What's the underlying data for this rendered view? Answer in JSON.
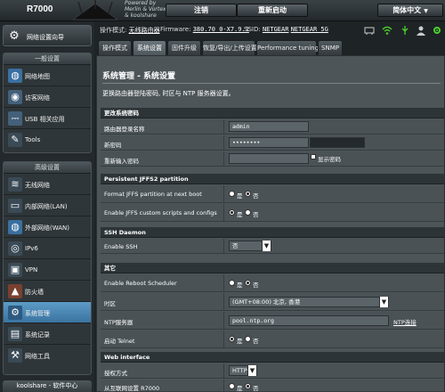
{
  "header": {
    "model": "R7000",
    "powered_by": [
      "Powered by",
      "Merlin & Vortex",
      "& koolshare"
    ],
    "logout_label": "注销",
    "reboot_label": "重新启动",
    "language_label": "简体中文"
  },
  "status": {
    "mode_label": "操作模式:",
    "mode_value": "无线路由器",
    "firmware_label": "Firmware:",
    "firmware_value": "380.70_0-X7.9.1",
    "ssid_label": "SSID:",
    "ssid_values": [
      "NETGEAR",
      "NETGEAR_5G"
    ],
    "icons": [
      "network-status-icon",
      "wifi-icon",
      "usb-icon",
      "user-icon",
      "settings-icon"
    ]
  },
  "sidebar": {
    "quick_setup": "网络设置向导",
    "general_title": "一般设置",
    "general_items": [
      {
        "label": "网络地图",
        "icon": "globe-icon"
      },
      {
        "label": "访客网络",
        "icon": "guest-network-icon"
      },
      {
        "label": "USB 相关应用",
        "icon": "usb-icon"
      },
      {
        "label": "Tools",
        "icon": "tools-icon"
      }
    ],
    "advanced_title": "高级设置",
    "advanced_items": [
      {
        "label": "无线网络",
        "icon": "wireless-icon"
      },
      {
        "label": "内部网络(LAN)",
        "icon": "lan-icon"
      },
      {
        "label": "外部网络(WAN)",
        "icon": "wan-icon"
      },
      {
        "label": "IPv6",
        "icon": "ipv6-icon"
      },
      {
        "label": "VPN",
        "icon": "vpn-icon"
      },
      {
        "label": "防火墙",
        "icon": "firewall-icon"
      },
      {
        "label": "系统管理",
        "icon": "administration-icon",
        "active": true
      },
      {
        "label": "系统记录",
        "icon": "system-log-icon"
      },
      {
        "label": "网络工具",
        "icon": "network-tools-icon"
      }
    ],
    "bottom_tab": "koolshare - 软件中心"
  },
  "tabs": [
    {
      "label": "操作模式"
    },
    {
      "label": "系统设置",
      "active": true
    },
    {
      "label": "固件升级"
    },
    {
      "label": "恢复/导出/上传设置"
    },
    {
      "label": "Performance tuning"
    },
    {
      "label": "SNMP"
    }
  ],
  "main": {
    "title": "系统管理 - 系统设置",
    "description": "更换路由器登陆密码, 时区与 NTP 服务器设置。",
    "password_section": {
      "title": "更改系统密码",
      "username_label": "路由器登录名称",
      "username_value": "admin",
      "new_password_label": "新密码",
      "new_password_value": "••••••••",
      "retype_label": "重新输入密码",
      "show_password_label": "显示密码"
    },
    "jffs_section": {
      "title": "Persistent JFFS2 partition",
      "format_label": "Format JFFS partition at next boot",
      "format_options": [
        "是",
        "否"
      ],
      "format_selected": "否",
      "enable_label": "Enable JFFS custom scripts and configs",
      "enable_options": [
        "是",
        "否"
      ],
      "enable_selected": "是"
    },
    "ssh_section": {
      "title": "SSH Daemon",
      "enable_label": "Enable SSH",
      "enable_value": "否"
    },
    "other_section": {
      "title": "其它",
      "reboot_sched_label": "Enable Reboot Scheduler",
      "reboot_sched_options": [
        "是",
        "否"
      ],
      "reboot_sched_selected": "否",
      "timezone_label": "时区",
      "timezone_value": "(GMT+08:00) 北京, 香港",
      "ntp_label": "NTP服务器",
      "ntp_value": "pool.ntp.org",
      "ntp_link": "NTP连接",
      "telnet_label": "启动 Telnet",
      "telnet_options": [
        "是",
        "否"
      ],
      "telnet_selected": "是"
    },
    "web_section": {
      "title": "Web interface",
      "auth_label": "授权方式",
      "auth_value": "HTTP",
      "wan_access_label": "从互联网设置 R7000",
      "wan_access_options": [
        "是",
        "否"
      ],
      "wan_access_selected": "否"
    }
  }
}
